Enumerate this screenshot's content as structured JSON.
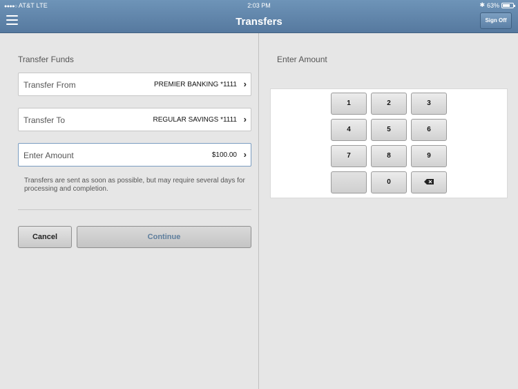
{
  "status_bar": {
    "carrier": "AT&T",
    "network": "LTE",
    "time": "2:03 PM",
    "battery": "63%",
    "battery_level": 0.63
  },
  "nav": {
    "title": "Transfers",
    "sign_off": "Sign Off"
  },
  "form": {
    "title": "Transfer Funds",
    "transfer_from": {
      "label": "Transfer From",
      "value": "PREMIER BANKING *1111"
    },
    "transfer_to": {
      "label": "Transfer To",
      "value": "REGULAR SAVINGS *1111"
    },
    "amount": {
      "label": "Enter Amount",
      "value": "$100.00"
    },
    "note": "Transfers are sent as soon as possible, but may require several days for processing and completion.",
    "cancel": "Cancel",
    "continue": "Continue"
  },
  "keypad": {
    "title": "Enter Amount",
    "keys": [
      "1",
      "2",
      "3",
      "4",
      "5",
      "6",
      "7",
      "8",
      "9",
      "",
      "0",
      "backspace-icon"
    ]
  },
  "colors": {
    "nav_bar": "#6183aa",
    "accent_text": "#5e7e9d"
  }
}
